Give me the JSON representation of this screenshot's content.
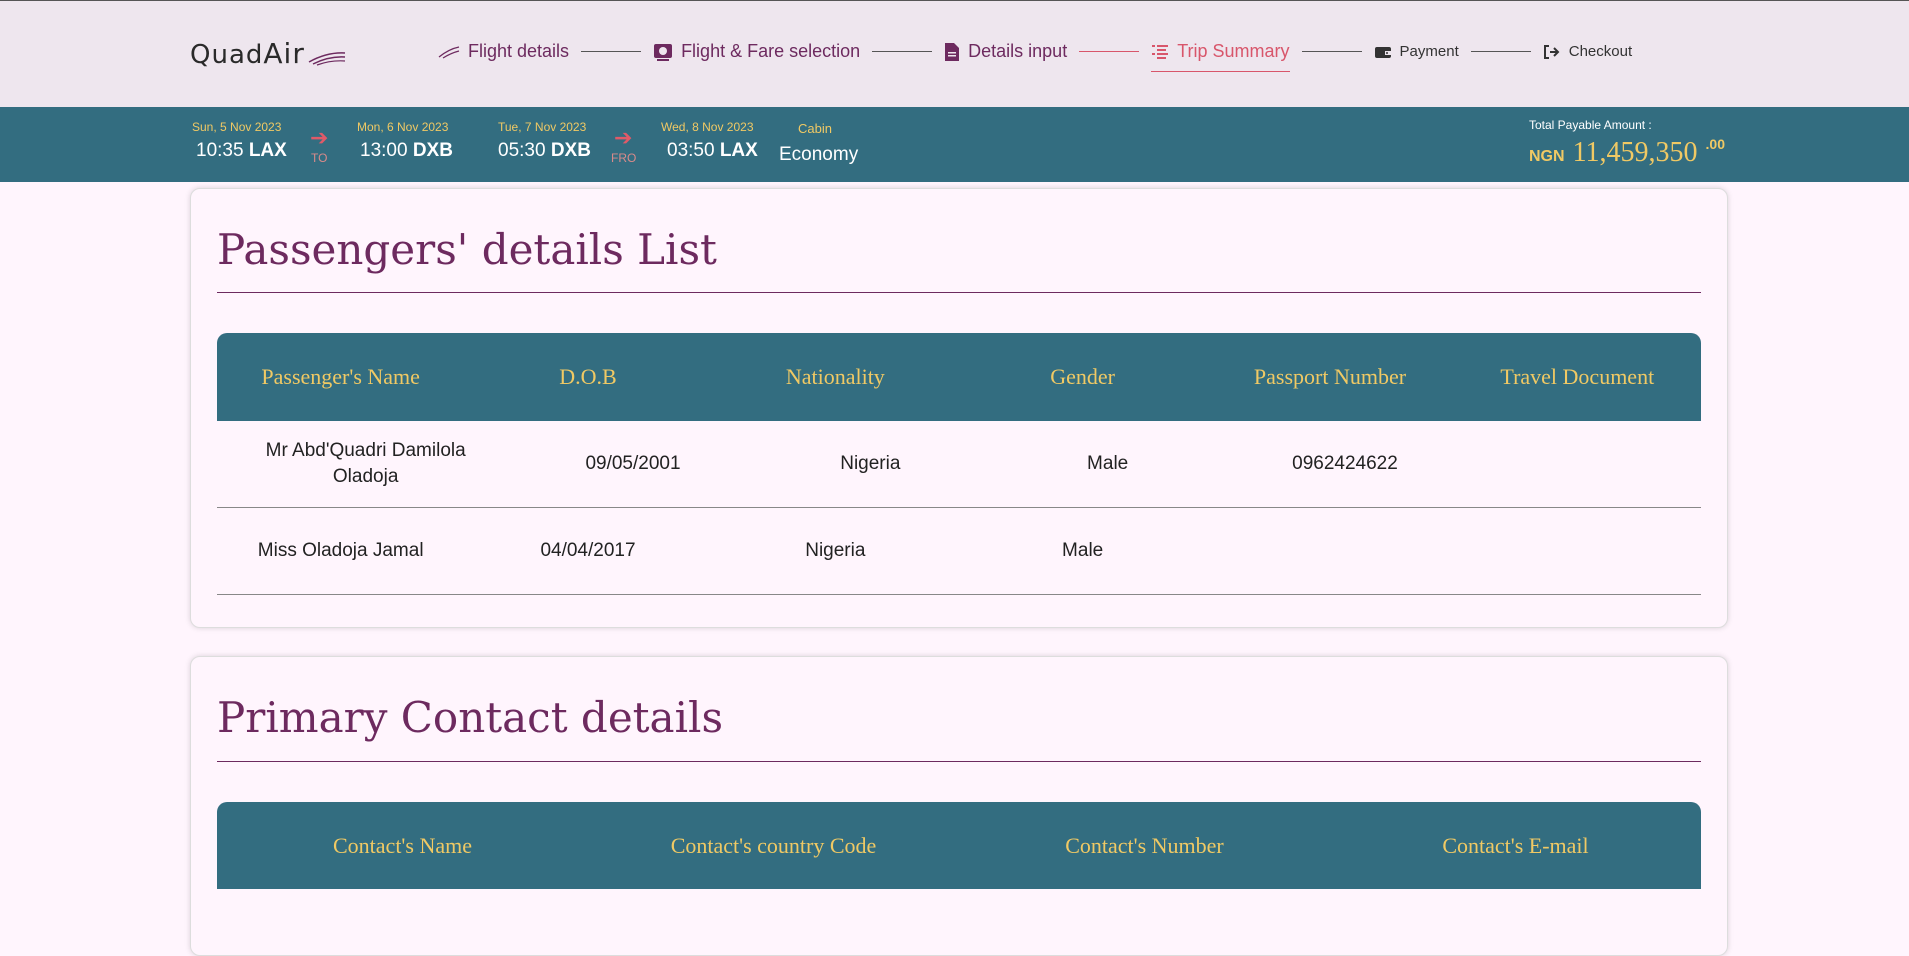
{
  "brand": {
    "name_part1": "Quad",
    "name_part2": "Air"
  },
  "steps": [
    {
      "label": "Flight details",
      "icon": "plane-icon"
    },
    {
      "label": "Flight & Fare selection",
      "icon": "fare-icon"
    },
    {
      "label": "Details input",
      "icon": "document-icon"
    },
    {
      "label": "Trip Summary",
      "icon": "list-icon"
    },
    {
      "label": "Payment",
      "icon": "wallet-icon"
    },
    {
      "label": "Checkout",
      "icon": "checkout-icon"
    }
  ],
  "itinerary": {
    "legs": [
      {
        "date": "Sun, 5 Nov 2023",
        "time": "10:35",
        "code": "LAX"
      },
      {
        "date": "Mon, 6 Nov 2023",
        "time": "13:00",
        "code": "DXB"
      },
      {
        "date": "Tue, 7 Nov 2023",
        "time": "05:30",
        "code": "DXB"
      },
      {
        "date": "Wed, 8 Nov 2023",
        "time": "03:50",
        "code": "LAX"
      }
    ],
    "to_label": "TO",
    "fro_label": "FRO",
    "cabin_label": "Cabin",
    "cabin_value": "Economy",
    "total_label": "Total Payable Amount :",
    "currency": "NGN",
    "amount": "11,459,350",
    "decimals": ".00"
  },
  "passengers": {
    "title": "Passengers' details List",
    "headers": [
      "Passenger's Name",
      "D.O.B",
      "Nationality",
      "Gender",
      "Passport Number",
      "Travel Document"
    ],
    "rows": [
      [
        "Mr Abd'Quadri Damilola Oladoja",
        "09/05/2001",
        "Nigeria",
        "Male",
        "0962424622",
        ""
      ],
      [
        "Miss Oladoja Jamal",
        "04/04/2017",
        "Nigeria",
        "Male",
        "",
        ""
      ]
    ]
  },
  "contact": {
    "title": "Primary Contact details",
    "headers": [
      "Contact's Name",
      "Contact's country Code",
      "Contact's Number",
      "Contact's E-mail"
    ]
  },
  "colors": {
    "teal": "#336d80",
    "gold": "#f0c964",
    "plum": "#6d2a5f",
    "accent": "#d8566b"
  }
}
